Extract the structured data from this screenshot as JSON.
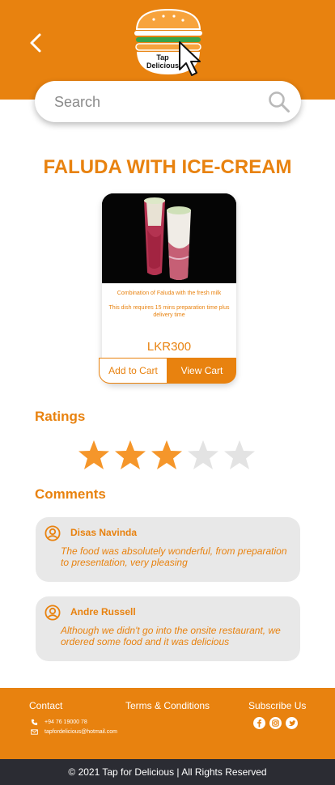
{
  "header": {
    "logo_text_line1": "Tap",
    "logo_text_line2": "Delicious"
  },
  "search": {
    "placeholder": "Search"
  },
  "product": {
    "title": "FALUDA WITH ICE-CREAM",
    "description": "Combination of Faluda with the fresh milk",
    "prep_note": "This dish requires 15 mins preparation time plus delivery time",
    "price": "LKR300",
    "add_to_cart_label": "Add to Cart",
    "view_cart_label": "View Cart"
  },
  "ratings": {
    "heading": "Ratings",
    "value": 3,
    "max": 5
  },
  "comments": {
    "heading": "Comments",
    "items": [
      {
        "name": "Disas Navinda",
        "text": "The food was absolutely wonderful, from preparation to presentation, very pleasing"
      },
      {
        "name": "Andre Russell",
        "text": "Although we didn't go into the onsite restaurant, we ordered some food and it was delicious"
      }
    ]
  },
  "footer": {
    "contact_label": "Contact",
    "phone": "+94 76 19000 78",
    "email": "tapfordelicious@hotmail.com",
    "terms_label": "Terms & Conditions",
    "subscribe_label": "Subscribe Us",
    "copyright": "© 2021 Tap for Delicious | All Rights Reserved"
  },
  "colors": {
    "accent": "#E8820F",
    "star_filled": "#F5962A",
    "star_empty": "#E3E3E3",
    "comment_bg": "#E8E8E8",
    "bottom_bar": "#2B2C33"
  },
  "icons": [
    "back-arrow-icon",
    "burger-logo-icon",
    "cursor-icon",
    "search-icon",
    "star-icon",
    "user-circle-icon",
    "phone-icon",
    "mail-icon",
    "facebook-icon",
    "instagram-icon",
    "twitter-icon"
  ]
}
